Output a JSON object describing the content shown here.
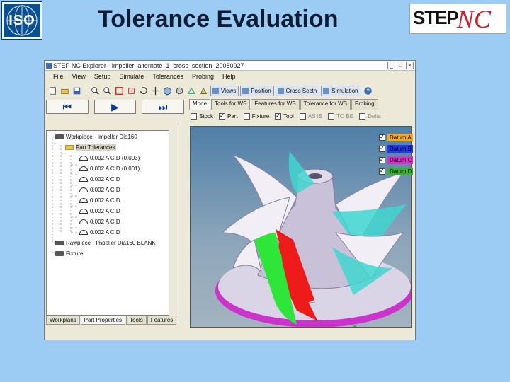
{
  "slide": {
    "title": "Tolerance Evaluation",
    "iso_logo_text": "ISO",
    "step_logo": {
      "step": "STEP",
      "nc": "NC"
    }
  },
  "window": {
    "title": "STEP NC Explorer - impeller_alternate_1_cross_section_20080927",
    "controls": [
      "_",
      "□",
      "×"
    ]
  },
  "menu": [
    "File",
    "View",
    "Setup",
    "Simulate",
    "Tolerances",
    "Probing",
    "Help"
  ],
  "toolbar": {
    "views_label": "Views",
    "position_label": "Position",
    "cross_section_label": "Cross Sectn",
    "simulation_label": "Simulation"
  },
  "nav": {
    "first": "⏮",
    "play": "▶",
    "last": "⏭"
  },
  "tabs": [
    "Mode",
    "Tools for WS",
    "Features for WS",
    "Tolerance for WS",
    "Probing"
  ],
  "checks": [
    {
      "label": "Stock",
      "checked": false,
      "dim": false
    },
    {
      "label": "Part",
      "checked": true,
      "dim": false
    },
    {
      "label": "Fixture",
      "checked": false,
      "dim": false
    },
    {
      "label": "Tool",
      "checked": true,
      "dim": false
    },
    {
      "label": "AS IS",
      "checked": false,
      "dim": true
    },
    {
      "label": "TO BE",
      "checked": false,
      "dim": true
    },
    {
      "label": "Delta",
      "checked": false,
      "dim": true
    }
  ],
  "tree": [
    {
      "label": "Workpiece - Impeller Dia160",
      "indent": 0,
      "icon": "printer",
      "expander": "-"
    },
    {
      "label": "Part Tolerances",
      "indent": 1,
      "icon": "folder",
      "expander": "-",
      "selected": true
    },
    {
      "label": "0.002 A C D (0.003)",
      "indent": 2,
      "icon": "tolerance"
    },
    {
      "label": "0.002 A C D (0.001)",
      "indent": 2,
      "icon": "tolerance"
    },
    {
      "label": "0.002 A C D",
      "indent": 2,
      "icon": "tolerance"
    },
    {
      "label": "0.002 A C D",
      "indent": 2,
      "icon": "tolerance"
    },
    {
      "label": "0.002 A C D",
      "indent": 2,
      "icon": "tolerance"
    },
    {
      "label": "0.002 A C D",
      "indent": 2,
      "icon": "tolerance"
    },
    {
      "label": "0.002 A C D",
      "indent": 2,
      "icon": "tolerance"
    },
    {
      "label": "0.002 A C D",
      "indent": 2,
      "icon": "tolerance"
    },
    {
      "label": "Rawpiece - Impeller Dia160 BLANK",
      "indent": 0,
      "icon": "printer",
      "expander": ""
    },
    {
      "label": "Fixture",
      "indent": 0,
      "icon": "printer",
      "expander": ""
    }
  ],
  "bottom_tabs": [
    {
      "label": "Workplans",
      "active": false
    },
    {
      "label": "Part Properties",
      "active": true
    },
    {
      "label": "Tools",
      "active": false
    },
    {
      "label": "Features",
      "active": false
    }
  ],
  "datums": [
    {
      "label": "Datum A",
      "color": "#f5a623"
    },
    {
      "label": "Datum B",
      "color": "#2036e8"
    },
    {
      "label": "Datum C",
      "color": "#d830c8"
    },
    {
      "label": "Datum D",
      "color": "#3ab02e"
    }
  ],
  "axes": {
    "z": "Z",
    "x": "X"
  },
  "colors": {
    "background": "#9ccbf4",
    "highlight_green": "#2ee63a",
    "highlight_red": "#ee1b1b",
    "base_magenta": "#cc33cc",
    "blade_teal": "#3fd6d0"
  }
}
